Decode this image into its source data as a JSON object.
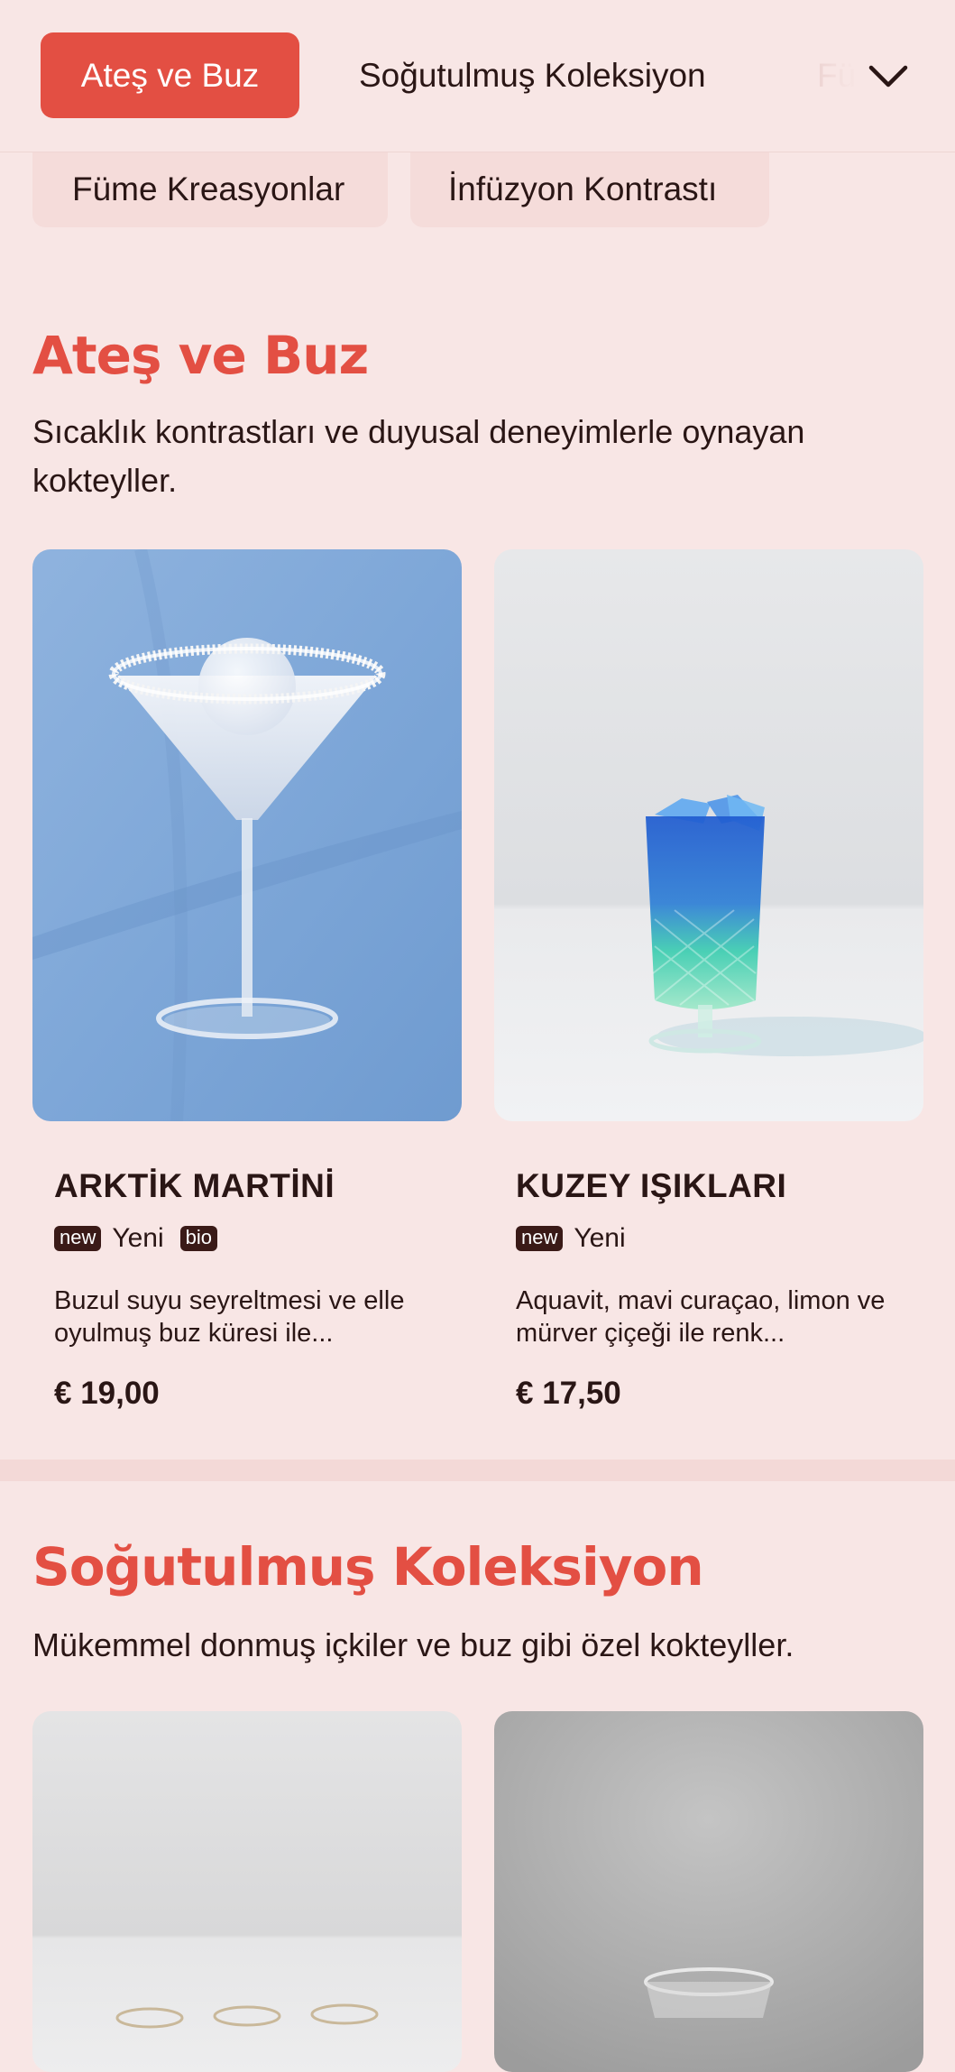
{
  "nav": {
    "tabs": [
      {
        "label": "Ateş ve Buz",
        "active": true
      },
      {
        "label": "Soğutulmuş Koleksiyon",
        "active": false
      },
      {
        "label": "Fü",
        "active": false
      }
    ],
    "chips": [
      {
        "label": "Füme Kreasyonlar"
      },
      {
        "label": "İnfüzyon Kontrastı"
      }
    ],
    "expand_icon": "chevron-down-icon"
  },
  "sections": [
    {
      "title": "Ateş ve Buz",
      "description": "Sıcaklık kontrastları ve duyusal deneyimlerle oynayan kokteyller.",
      "items": [
        {
          "name": "ARKTİK MARTİNİ",
          "tags": [
            {
              "code": "new",
              "label": "Yeni"
            },
            {
              "code": "bio",
              "label": ""
            }
          ],
          "description": "Buzul suyu seyreltmesi ve elle oyulmuş buz küresi ile...",
          "price": "€ 19,00"
        },
        {
          "name": "KUZEY IŞIKLARI",
          "tags": [
            {
              "code": "new",
              "label": "Yeni"
            }
          ],
          "description": "Aquavit, mavi curaçao, limon ve mürver çiçeği ile renk...",
          "price": "€ 17,50"
        }
      ]
    },
    {
      "title": "Soğutulmuş Koleksiyon",
      "description": "Mükemmel donmuş içkiler ve buz gibi özel kokteyller."
    }
  ],
  "colors": {
    "accent": "#e34f43",
    "background": "#f8e6e5",
    "text": "#2a1615",
    "tag_bg": "#3a1a17"
  }
}
